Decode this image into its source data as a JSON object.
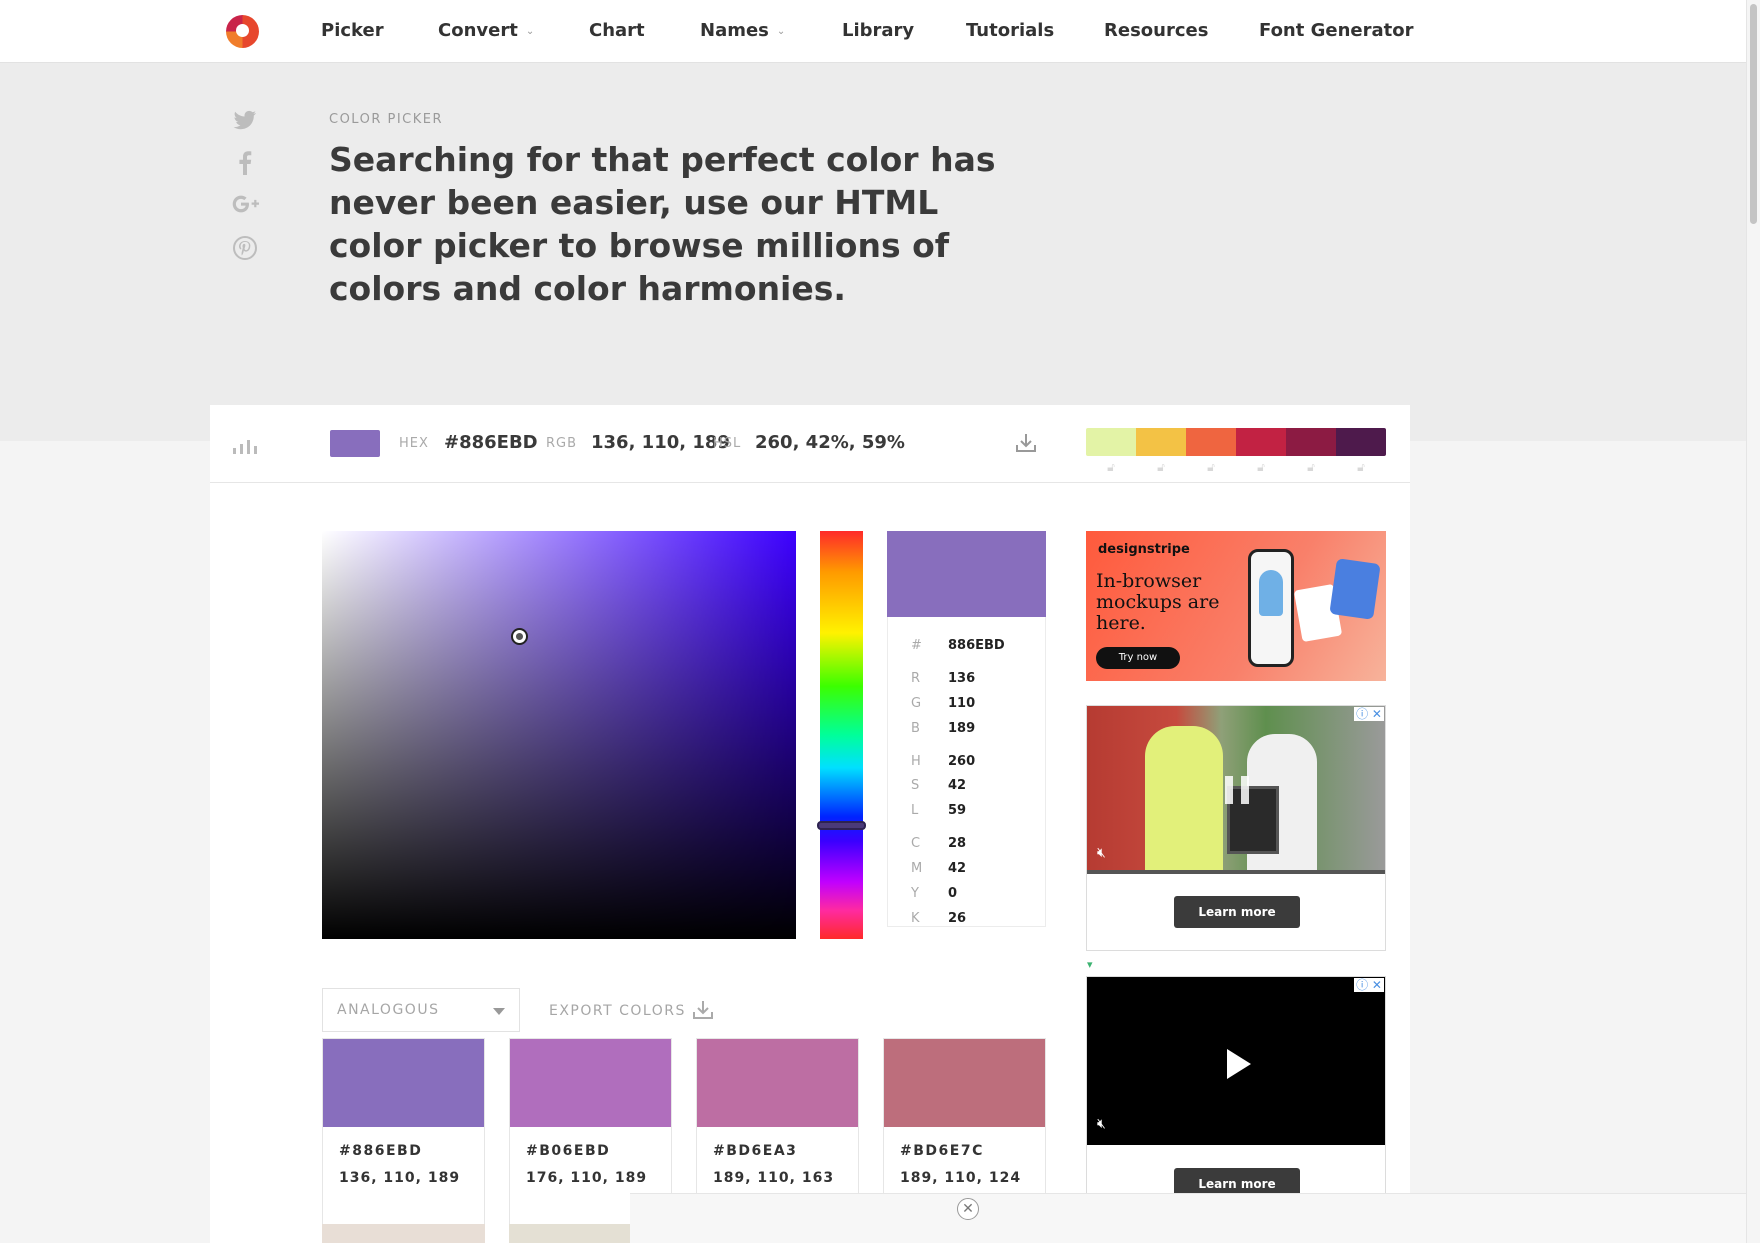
{
  "nav": {
    "items": [
      {
        "label": "Picker"
      },
      {
        "label": "Convert",
        "dropdown": true
      },
      {
        "label": "Chart"
      },
      {
        "label": "Names",
        "dropdown": true
      },
      {
        "label": "Library"
      },
      {
        "label": "Tutorials"
      },
      {
        "label": "Resources"
      },
      {
        "label": "Font Generator"
      }
    ]
  },
  "social": [
    "twitter-icon",
    "facebook-icon",
    "google-plus-icon",
    "pinterest-icon"
  ],
  "hero": {
    "eyebrow": "COLOR PICKER",
    "headline": "Searching for that perfect color has never been easier, use our HTML color picker to browse millions of colors and color harmonies."
  },
  "toolbar": {
    "hex_label": "HEX",
    "hex_value": "#886EBD",
    "rgb_label": "RGB",
    "rgb_value": "136, 110, 189",
    "hsl_label": "HSL",
    "hsl_value": "260, 42%, 59%",
    "current_color": "#886EBD"
  },
  "palette": [
    "#E3F3A6",
    "#F3C245",
    "#EF6540",
    "#C22243",
    "#8C1B43",
    "#4E1A4C"
  ],
  "info": {
    "hash_label": "#",
    "hex": "886EBD",
    "r_label": "R",
    "r": "136",
    "g_label": "G",
    "g": "110",
    "b_label": "B",
    "b": "189",
    "h_label": "H",
    "h": "260",
    "s_label": "S",
    "s": "42",
    "l_label": "L",
    "l": "59",
    "c_label": "C",
    "c": "28",
    "m_label": "M",
    "m": "42",
    "y_label": "Y",
    "y": "0",
    "k_label": "K",
    "k": "26"
  },
  "harmony": {
    "mode": "ANALOGOUS",
    "export_label": "EXPORT COLORS",
    "colors": [
      {
        "hex": "#886EBD",
        "rgb": "136, 110, 189"
      },
      {
        "hex": "#B06EBD",
        "rgb": "176, 110, 189"
      },
      {
        "hex": "#BD6EA3",
        "rgb": "189, 110, 163"
      },
      {
        "hex": "#BD6E7C",
        "rgb": "189, 110, 124"
      }
    ]
  },
  "ads": {
    "ad1_brand": "designstripe",
    "ad1_copy": "In-browser mockups are here.",
    "ad1_cta": "Try now",
    "learn_more": "Learn more",
    "adchoices": "ⓘ ✕"
  }
}
